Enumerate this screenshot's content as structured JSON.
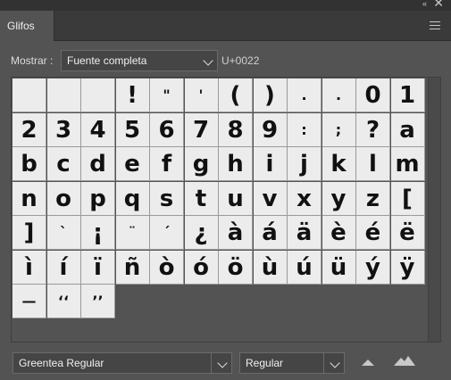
{
  "window": {
    "collapse_glyph": "«",
    "close_glyph": "✕"
  },
  "tab": {
    "label": "Glifos"
  },
  "show": {
    "label": "Mostrar :",
    "selected": "Fuente completa",
    "unicode": "U+0022"
  },
  "glyphs": [
    "",
    "",
    "",
    "!",
    "\"",
    "'",
    "(",
    ")",
    ".",
    ".",
    "0",
    "1",
    "2",
    "3",
    "4",
    "5",
    "6",
    "7",
    "8",
    "9",
    ":",
    ";",
    "?",
    "a",
    "b",
    "c",
    "d",
    "e",
    "f",
    "g",
    "h",
    "i",
    "j",
    "k",
    "l",
    "m",
    "n",
    "o",
    "p",
    "q",
    "s",
    "t",
    "u",
    "v",
    "x",
    "y",
    "z",
    "[",
    "]",
    "`",
    "¡",
    "¨",
    "´",
    "¿",
    "à",
    "á",
    "ä",
    "è",
    "é",
    "ë",
    "ì",
    "í",
    "ï",
    "ñ",
    "ò",
    "ó",
    "ö",
    "ù",
    "ú",
    "ü",
    "ý",
    "ÿ",
    "—",
    "‘‘",
    "’’"
  ],
  "font": {
    "family": "Greentea  Regular",
    "style": "Regular"
  },
  "icons": {
    "zoom_out": "mountain-small-icon",
    "zoom_in": "mountain-large-icon",
    "menu": "hamburger-icon"
  }
}
